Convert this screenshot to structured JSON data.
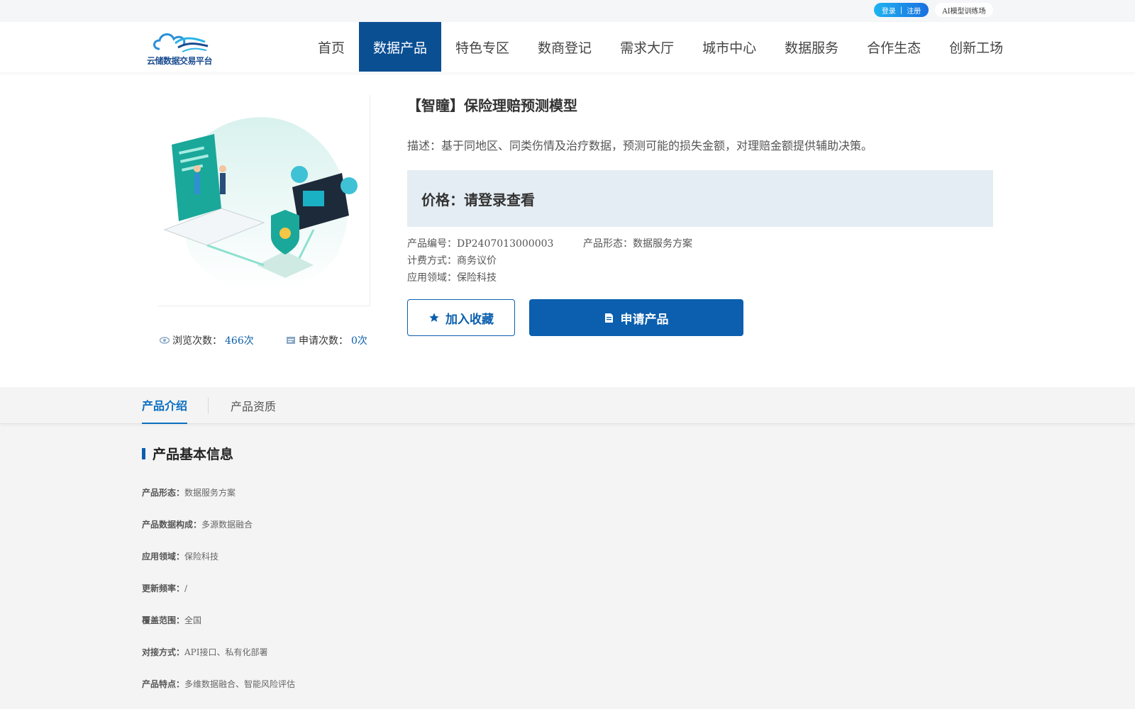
{
  "topbar": {
    "login": "登录",
    "separator": "|",
    "register": "注册",
    "ai_training": "AI模型训练场"
  },
  "logo": {
    "text": "云储数据交易平台"
  },
  "nav": [
    {
      "label": "首页",
      "active": false
    },
    {
      "label": "数据产品",
      "active": true
    },
    {
      "label": "特色专区",
      "active": false
    },
    {
      "label": "数商登记",
      "active": false
    },
    {
      "label": "需求大厅",
      "active": false
    },
    {
      "label": "城市中心",
      "active": false
    },
    {
      "label": "数据服务",
      "active": false
    },
    {
      "label": "合作生态",
      "active": false
    },
    {
      "label": "创新工场",
      "active": false
    }
  ],
  "product": {
    "title": "【智瞳】保险理赔预测模型",
    "description": "描述：基于同地区、同类伤情及治疗数据，预测可能的损失金额，对理赔金额提供辅助决策。",
    "price": "价格：请登录查看",
    "code_label": "产品编号：",
    "code": "DP2407013000003",
    "form_label": "产品形态：",
    "form": "数据服务方案",
    "billing_label": "计费方式：",
    "billing": "商务议价",
    "domain_label": "应用领域：",
    "domain": "保险科技",
    "views_label": "浏览次数：",
    "views": "466次",
    "applies_label": "申请次数：",
    "applies": "0次",
    "favorite_button": "加入收藏",
    "apply_button": "申请产品"
  },
  "tabs": [
    {
      "label": "产品介绍",
      "active": true
    },
    {
      "label": "产品资质",
      "active": false
    }
  ],
  "basic_info": {
    "heading": "产品基本信息",
    "rows": [
      {
        "label": "产品形态：",
        "value": "数据服务方案"
      },
      {
        "label": "产品数据构成：",
        "value": "多源数据融合"
      },
      {
        "label": "应用领域：",
        "value": "保险科技"
      },
      {
        "label": "更新频率：",
        "value": "/"
      },
      {
        "label": "覆盖范围：",
        "value": "全国"
      },
      {
        "label": "对接方式：",
        "value": "API接口、私有化部署"
      },
      {
        "label": "产品特点：",
        "value": "多维数据融合、智能风险评估"
      }
    ]
  },
  "colors": {
    "primary": "#0b5fae",
    "nav_active": "#0b4f93",
    "price_bg": "#e4edf3",
    "tab_active": "#0b6fc2"
  },
  "icons": [
    "eye-icon",
    "document-icon",
    "star-icon",
    "file-icon",
    "logo-cloud-icon"
  ]
}
